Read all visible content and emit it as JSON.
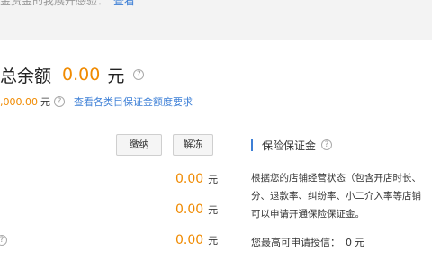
{
  "top_notice": {
    "text": "金资金的我展开感验：",
    "link_label": "查看"
  },
  "summary": {
    "total_label": "总余额",
    "total_value": "0.00",
    "total_unit": "元",
    "quota_value": ",000.00",
    "quota_unit": "元",
    "quota_link": "查看各类目保证金额度要求"
  },
  "actions": {
    "pay_label": "缴纳",
    "thaw_label": "解冻"
  },
  "amounts": [
    {
      "value": "0.00",
      "unit": "元"
    },
    {
      "value": "0.00",
      "unit": "元"
    },
    {
      "value": "0.00",
      "unit": "元"
    }
  ],
  "insurance": {
    "title": "保险保证金",
    "description": [
      "根据您的店铺经营状态（包含开店时长、",
      "分、退款率、纠纷率、小二介入率等店铺",
      "可以申请开通保险保证金。"
    ],
    "credit_label": "您最高可申请授信：",
    "credit_value": "0",
    "credit_unit": "元"
  },
  "colors": {
    "accent": "#f08a00",
    "link": "#3d7fd6",
    "background": "#f3f3f3"
  },
  "icons": {
    "help": "question-circle-icon"
  }
}
